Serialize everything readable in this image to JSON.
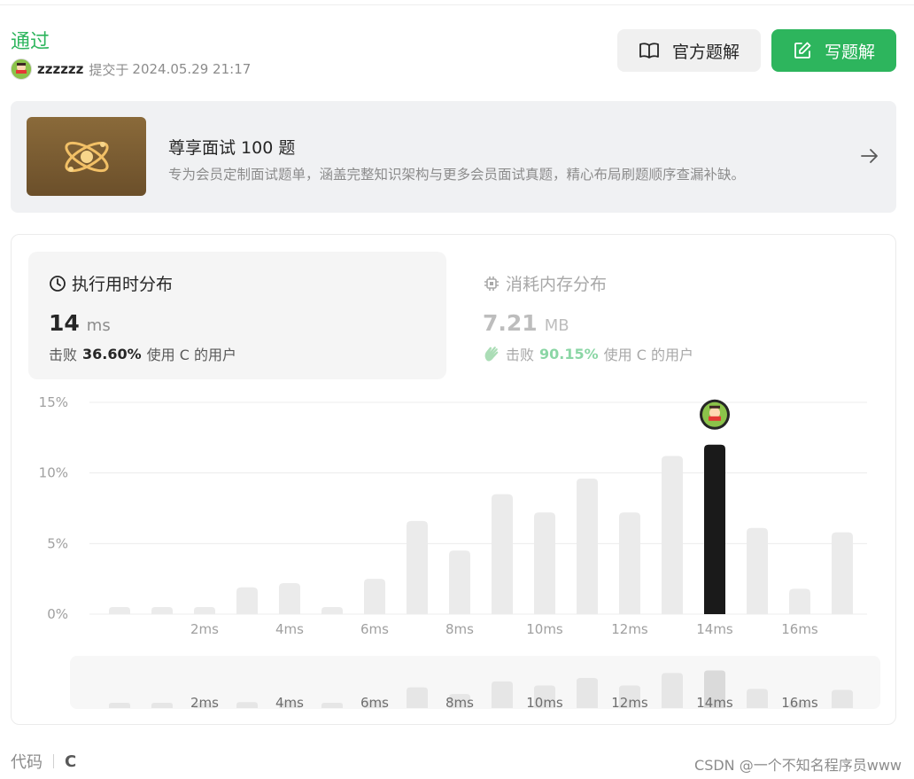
{
  "result": {
    "status": "通过",
    "username": "zzzzzz",
    "submit_prefix": "提交于",
    "submit_time": "2024.05.29 21:17"
  },
  "actions": {
    "official_label": "官方题解",
    "write_label": "写题解"
  },
  "banner": {
    "title": "尊享面试 100 题",
    "description": "专为会员定制面试题单，涵盖完整知识架构与更多会员面试真题，精心布局刷题顺序查漏补缺。"
  },
  "tabs": {
    "runtime": {
      "title": "执行用时分布",
      "value": "14",
      "unit": "ms",
      "beat_prefix": "击败",
      "beat_value": "36.60%",
      "beat_suffix": "使用 C 的用户"
    },
    "memory": {
      "title": "消耗内存分布",
      "value": "7.21",
      "unit": "MB",
      "beat_prefix": "击败",
      "beat_value": "90.15%",
      "beat_suffix": "使用 C 的用户"
    }
  },
  "chart_data": {
    "type": "bar",
    "title": "",
    "xlabel": "",
    "ylabel": "",
    "ylim": [
      0,
      15
    ],
    "yticks": [
      "0%",
      "5%",
      "10%",
      "15%"
    ],
    "ytick_values": [
      0,
      5,
      10,
      15
    ],
    "categories": [
      "0ms",
      "1ms",
      "2ms",
      "3ms",
      "4ms",
      "5ms",
      "6ms",
      "7ms",
      "8ms",
      "9ms",
      "10ms",
      "11ms",
      "12ms",
      "13ms",
      "14ms",
      "15ms",
      "16ms",
      "17ms"
    ],
    "x_tick_labels": [
      "2ms",
      "4ms",
      "6ms",
      "8ms",
      "10ms",
      "12ms",
      "14ms",
      "16ms"
    ],
    "values": [
      0.5,
      0.5,
      0.5,
      1.9,
      2.2,
      0.5,
      2.5,
      6.6,
      4.5,
      8.5,
      7.2,
      9.6,
      7.2,
      11.2,
      12.0,
      6.1,
      1.8,
      5.8
    ],
    "highlight_index": 14,
    "grid": true,
    "colors": {
      "bar": "#ebebeb",
      "highlight": "#1a1a1a",
      "grid": "#ececec",
      "tick": "#a0a0a0"
    }
  },
  "code": {
    "label": "代码",
    "language": "C"
  },
  "watermark": "CSDN @一个不知名程序员www"
}
